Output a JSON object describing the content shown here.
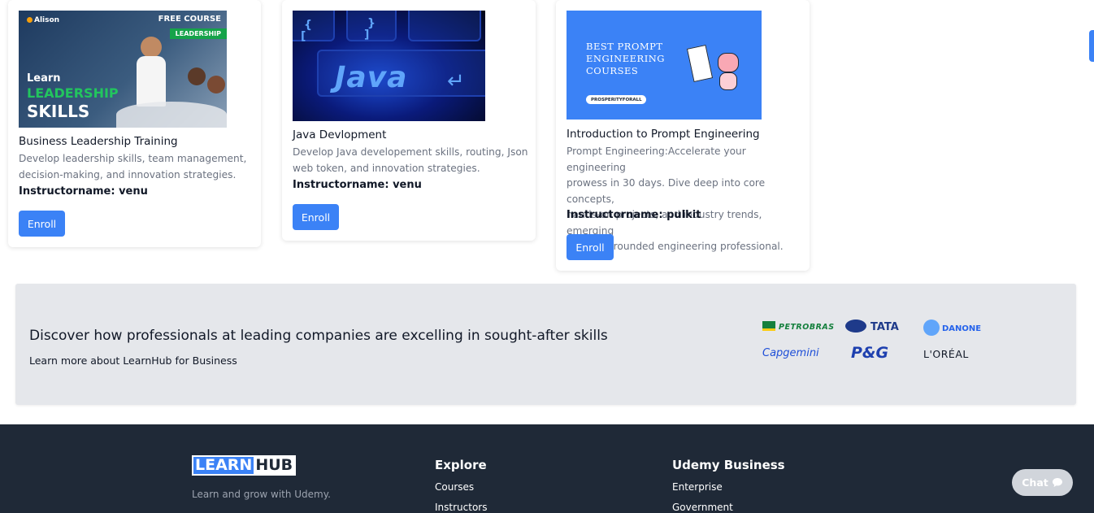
{
  "courses": [
    {
      "title": "Business Leadership Training",
      "desc_lines": [
        "Develop leadership skills, team management,",
        "decision-making, and innovation strategies."
      ],
      "instructor": "Instructorname: venu",
      "enroll": "Enroll",
      "thumb": {
        "brand": "Alison",
        "badge": "FREE COURSE",
        "tag": "LEADERSHIP",
        "line1": "Learn",
        "line2": "LEADERSHIP",
        "line3": "SKILLS"
      }
    },
    {
      "title": "Java Devlopment",
      "desc_lines": [
        "Develop Java developement skills, routing, Json",
        "web token, and innovation strategies."
      ],
      "instructor": "Instructorname: venu",
      "enroll": "Enroll",
      "thumb": {
        "word": "Java"
      }
    },
    {
      "title": "Introduction to Prompt Engineering",
      "desc_lines": [
        "Prompt Engineering:Accelerate your engineering",
        "prowess in 30 days. Dive deep into core concepts,",
        "hands-on projects, and industry trends, emerging",
        "as a well-rounded engineering professional."
      ],
      "instructor": "Instructorname: pulkit",
      "enroll": "Enroll",
      "thumb": {
        "lines": [
          "BEST PROMPT",
          "ENGINEERING",
          "COURSES"
        ],
        "pill": "PROSPERITYFORALL"
      }
    }
  ],
  "business": {
    "heading": "Discover how professionals at leading companies are excelling in sought-after skills",
    "sub": "Learn more about LearnHub for Business",
    "logos": [
      "PETROBRAS",
      "TATA",
      "DANONE",
      "Capgemini",
      "P&G",
      "L'ORÉAL"
    ]
  },
  "footer": {
    "brand_a": "LEARN",
    "brand_b": "HUB",
    "tagline": "Learn and grow with Udemy.",
    "explore": {
      "heading": "Explore",
      "links": [
        "Courses",
        "Instructors"
      ]
    },
    "business": {
      "heading": "Udemy Business",
      "links": [
        "Enterprise",
        "Government"
      ]
    }
  },
  "chat": {
    "label": "Chat",
    "icon": "chat-bubble-icon"
  },
  "colors": {
    "accent": "#3b82f6",
    "footer_bg": "#1f2937",
    "banner_bg": "#e5e7eb"
  }
}
